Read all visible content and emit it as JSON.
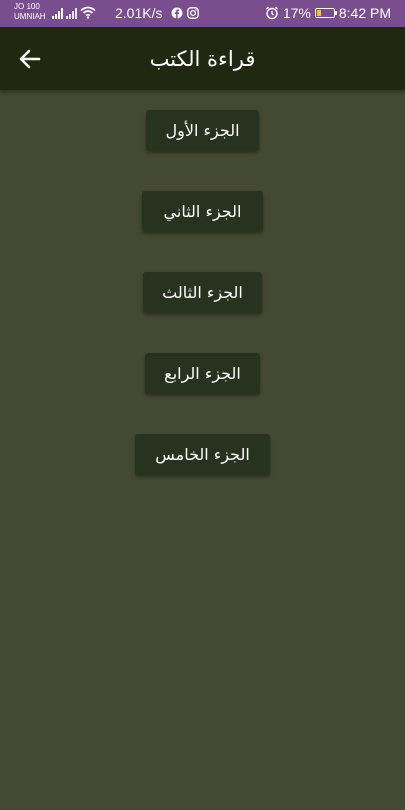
{
  "status_bar": {
    "carrier_line1": "JO 100",
    "carrier_line2": "UMNIAH",
    "network_speed": "2.01K/s",
    "battery_percent": "17%",
    "time": "8:42 PM",
    "battery_level": 0.17,
    "icons": [
      "signal-icon",
      "wifi-icon",
      "facebook-icon",
      "instagram-icon",
      "alarm-icon",
      "battery-icon"
    ]
  },
  "app_bar": {
    "title": "قراءة الكتب",
    "back_icon": "arrow-left-icon"
  },
  "parts": [
    {
      "label": "الجزء الأول"
    },
    {
      "label": "الجزء الثاني"
    },
    {
      "label": "الجزء الثالث"
    },
    {
      "label": "الجزء الرابع"
    },
    {
      "label": "الجزء الخامس"
    }
  ],
  "colors": {
    "status_bar": "#7a4e8e",
    "app_bar": "#202812",
    "background": "#434932",
    "button": "#27321f",
    "text": "#ffffff"
  }
}
